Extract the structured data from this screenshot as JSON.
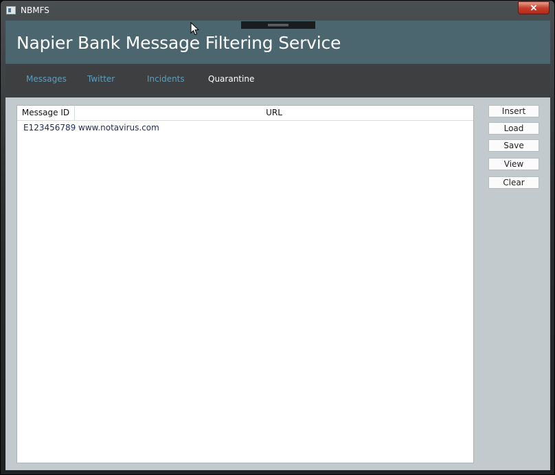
{
  "window": {
    "title": "NBMFS",
    "close_glyph": "✕"
  },
  "header": {
    "app_title": "Napier Bank Message Filtering Service"
  },
  "nav": {
    "tabs": [
      {
        "label": "Messages",
        "active": false
      },
      {
        "label": "Twitter",
        "active": false
      },
      {
        "label": "Incidents",
        "active": false
      },
      {
        "label": "Quarantine",
        "active": true
      }
    ]
  },
  "grid": {
    "columns": [
      "Message ID",
      "URL"
    ],
    "rows": [
      {
        "message_id": "E123456789",
        "url": "www.notavirus.com"
      }
    ]
  },
  "actions": {
    "insert": "Insert",
    "load": "Load",
    "save": "Save",
    "view": "View",
    "clear": "Clear"
  },
  "colors": {
    "header_bg": "#4c6670",
    "nav_bg": "#3d3f40",
    "nav_link": "#5d9fc0",
    "content_bg": "#c2cacd"
  }
}
